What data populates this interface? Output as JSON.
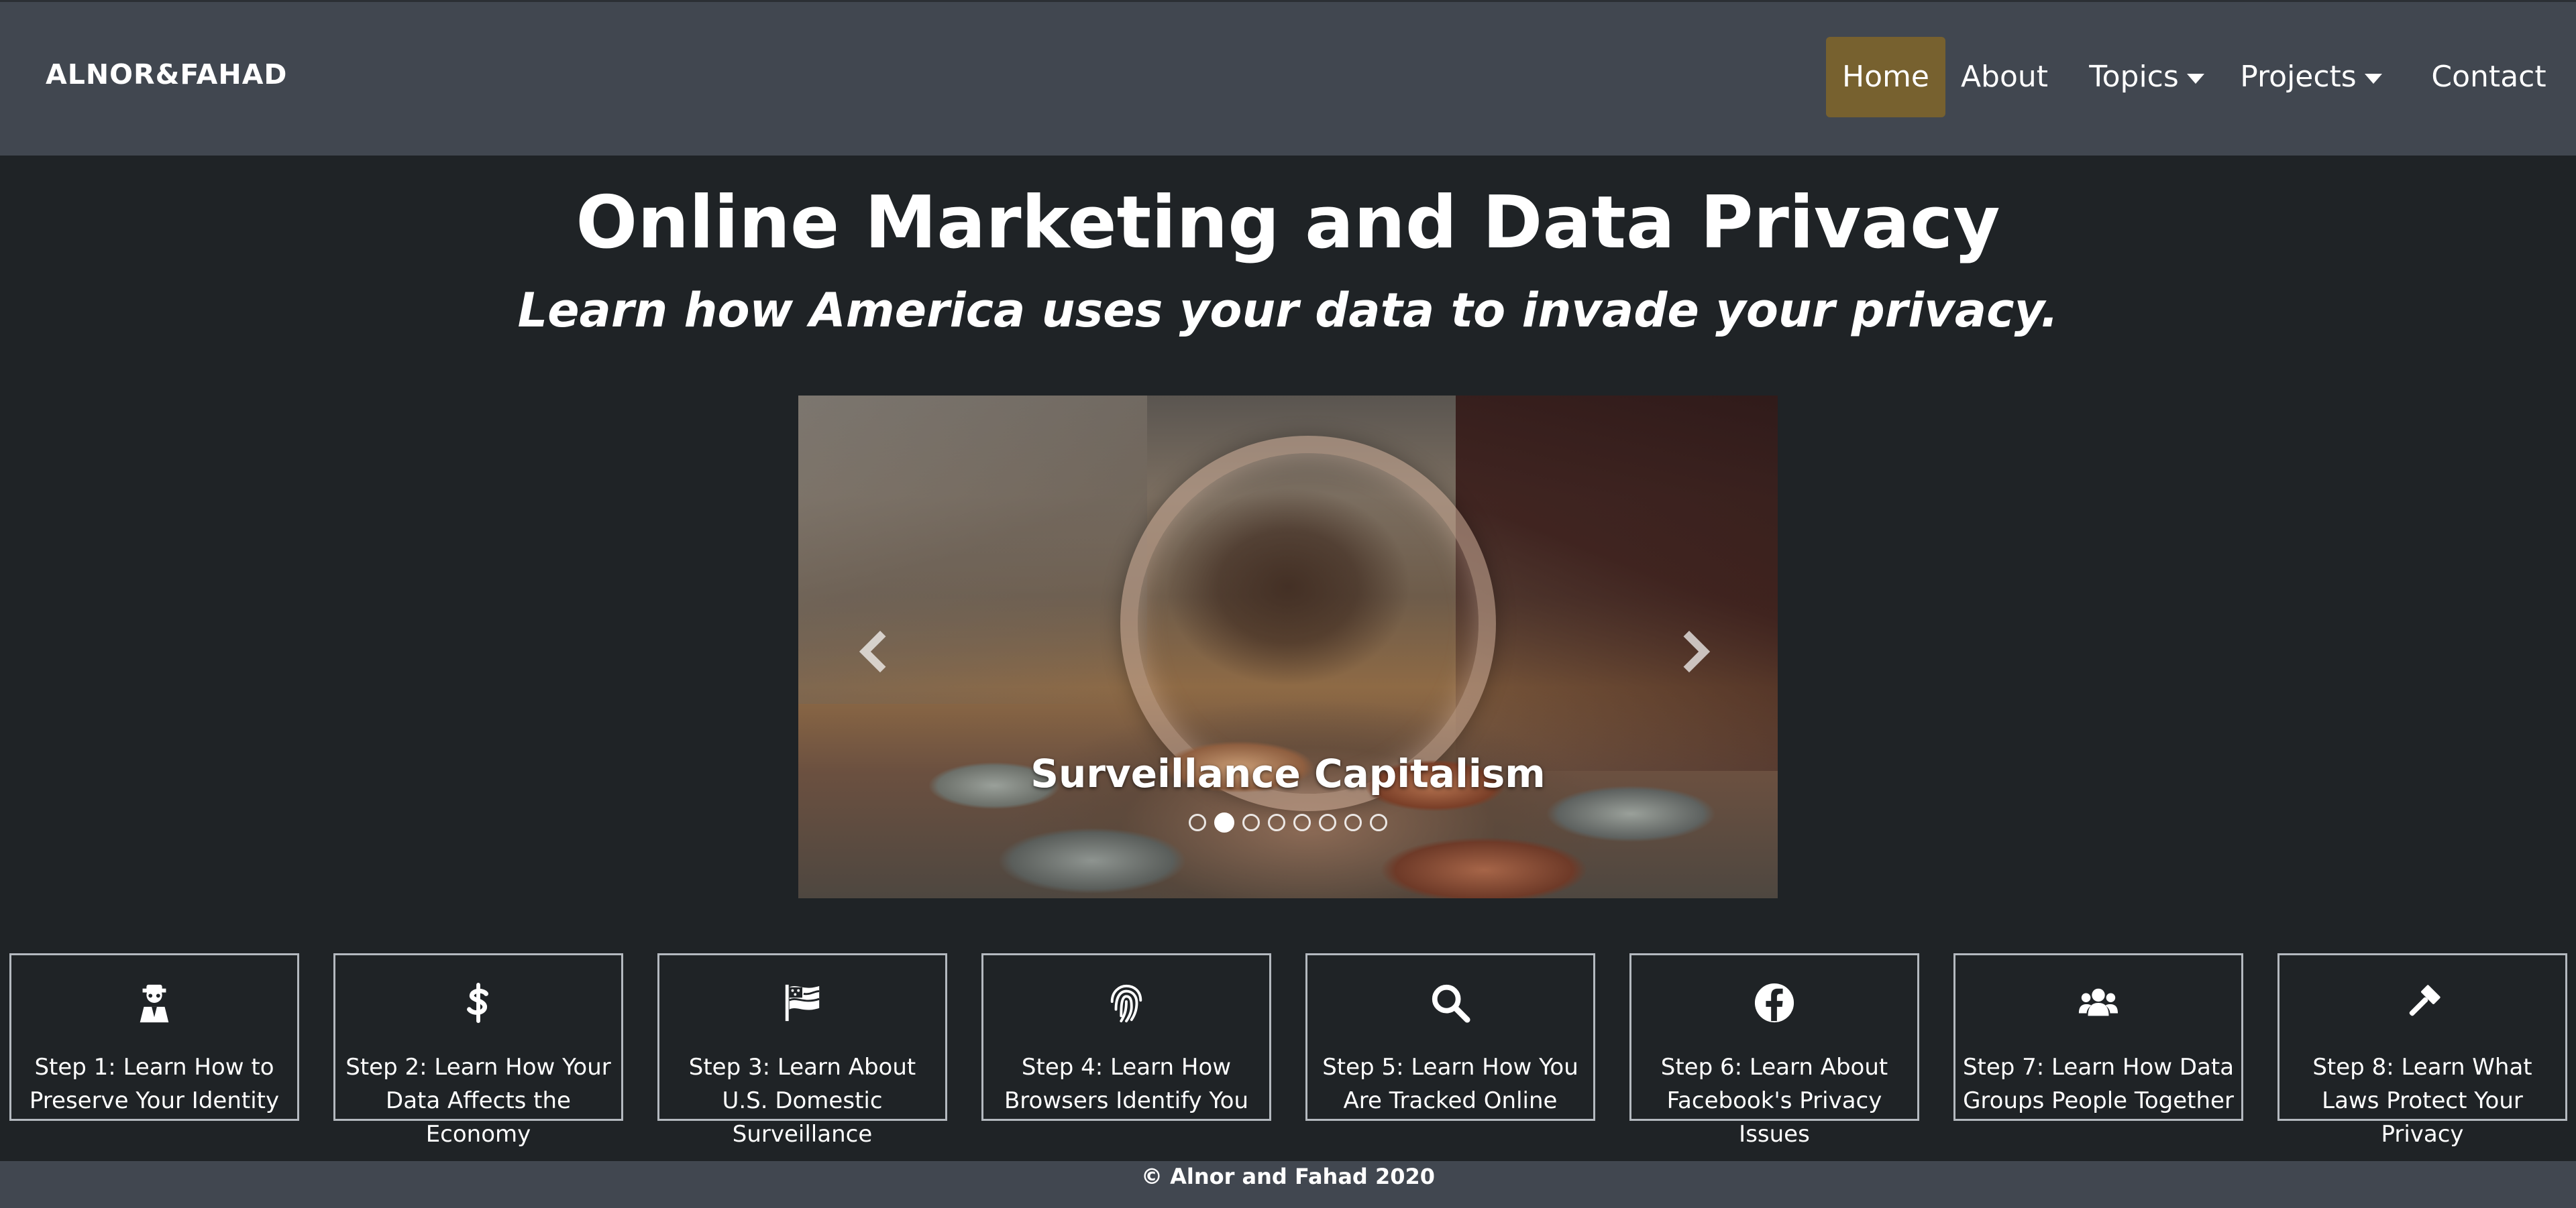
{
  "navbar": {
    "brand": "ALNOR&FAHAD",
    "items": [
      {
        "label": "Home",
        "active": true
      },
      {
        "label": "About"
      },
      {
        "label": "Topics",
        "dropdown": true
      },
      {
        "label": "Projects",
        "dropdown": true
      },
      {
        "label": "Contact"
      }
    ],
    "active_color": "#77612f",
    "background": "#414750"
  },
  "hero": {
    "title": "Online Marketing and Data Privacy",
    "subtitle": "Learn how America uses your data to invade your privacy."
  },
  "carousel": {
    "caption": "Surveillance Capitalism",
    "prev_icon": "chevron-left-icon",
    "next_icon": "chevron-right-icon",
    "slide_count": 8,
    "active_index": 2
  },
  "steps": [
    {
      "icon": "user-secret-icon",
      "label": "Step 1: Learn How to Preserve Your Identity"
    },
    {
      "icon": "dollar-sign-icon",
      "label": "Step 2: Learn How Your Data Affects the Economy"
    },
    {
      "icon": "flag-usa-icon",
      "label": "Step 3: Learn About U.S. Domestic Surveillance"
    },
    {
      "icon": "fingerprint-icon",
      "label": "Step 4: Learn How Browsers Identify You"
    },
    {
      "icon": "search-icon",
      "label": "Step 5: Learn How You Are Tracked Online"
    },
    {
      "icon": "facebook-icon",
      "label": "Step 6: Learn About Facebook's Privacy Issues"
    },
    {
      "icon": "users-icon",
      "label": "Step 7: Learn How Data Groups People Together"
    },
    {
      "icon": "gavel-icon",
      "label": "Step 8: Learn What Laws Protect Your Privacy"
    }
  ],
  "footer": {
    "text": "© Alnor and Fahad 2020"
  }
}
